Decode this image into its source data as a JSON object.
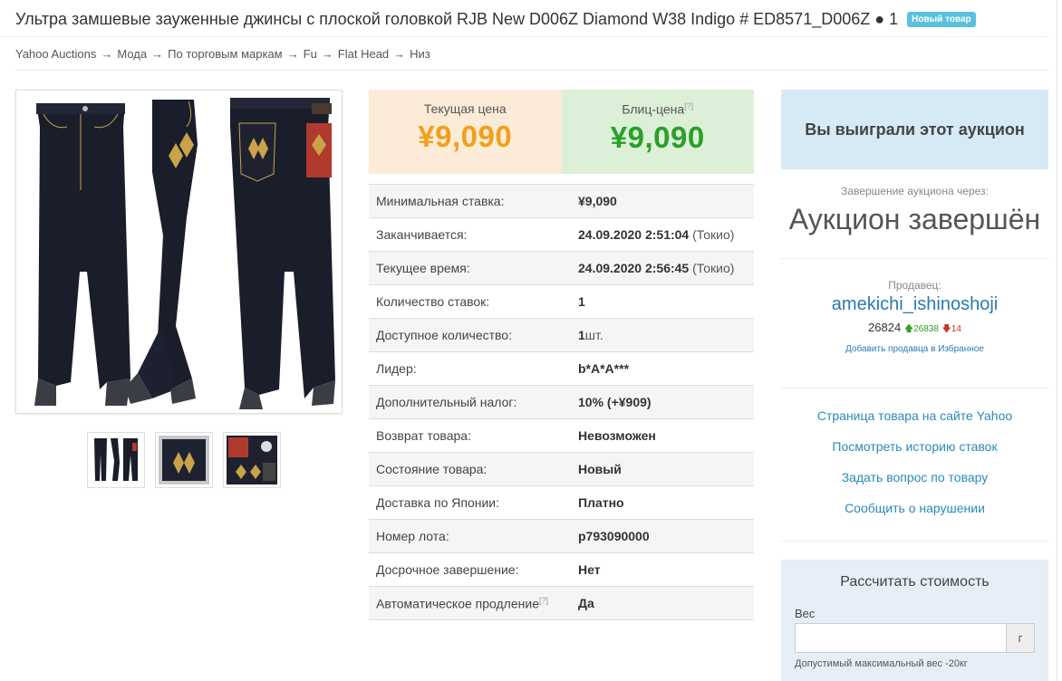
{
  "header": {
    "title": "Ультра замшевые зауженные джинсы с плоской головкой RJB New D006Z Diamond W38 Indigo # ED8571_D006Z ● 1",
    "badge": "Новый товар"
  },
  "breadcrumb": [
    "Yahoo Auctions",
    "Мода",
    "По торговым маркам",
    "Fu",
    "Flat Head",
    "Низ"
  ],
  "breadcrumb_sep": "→",
  "prices": {
    "current_label": "Текущая цена",
    "current_value": "¥9,090",
    "blitz_label": "Блиц-цена",
    "blitz_help": "[?]",
    "blitz_value": "¥9,090"
  },
  "details": [
    {
      "label": "Минимальная ставка:",
      "value": "¥9,090"
    },
    {
      "label": "Заканчивается:",
      "value": "24.09.2020 2:51:04",
      "note": "(Токио)"
    },
    {
      "label": "Текущее время:",
      "value": "24.09.2020 2:56:45",
      "note": "(Токио)"
    },
    {
      "label": "Количество ставок:",
      "value": "1"
    },
    {
      "label": "Доступное количество:",
      "value": "1",
      "note": "шт."
    },
    {
      "label": "Лидер:",
      "value": "b*A*A***"
    },
    {
      "label": "Дополнительный налог:",
      "value": "10% (+¥909)"
    },
    {
      "label": "Возврат товара:",
      "value": "Невозможен"
    },
    {
      "label": "Состояние товара:",
      "value": "Новый"
    },
    {
      "label": "Доставка по Японии:",
      "value": "Платно"
    },
    {
      "label": "Номер лота:",
      "value": "p793090000"
    },
    {
      "label": "Досрочное завершение:",
      "value": "Нет"
    },
    {
      "label": "Автоматическое продление",
      "help": "[?]",
      "value": "Да"
    }
  ],
  "auction_status": {
    "won_text": "Вы выиграли этот аукцион",
    "end_label": "Завершение аукциона через:",
    "end_status": "Аукцион завершён"
  },
  "seller": {
    "label": "Продавец:",
    "name": "amekichi_ishinoshoji",
    "rating": "26824",
    "positive": "26838",
    "negative": "14",
    "fav_link": "Добавить продавца в Избранное"
  },
  "links": [
    "Страница товара на сайте Yahoo",
    "Посмотреть историю ставок",
    "Задать вопрос по товару",
    "Сообщить о нарушении"
  ],
  "calculator": {
    "title": "Рассчитать стоимость",
    "weight_label": "Вес",
    "unit": "г",
    "note": "Допустимый максимальный вес -20кг"
  },
  "colors": {
    "current_price": "#f0a01c",
    "blitz_price": "#2aa02a",
    "link": "#2a8ab8",
    "badge": "#5bc0de"
  }
}
